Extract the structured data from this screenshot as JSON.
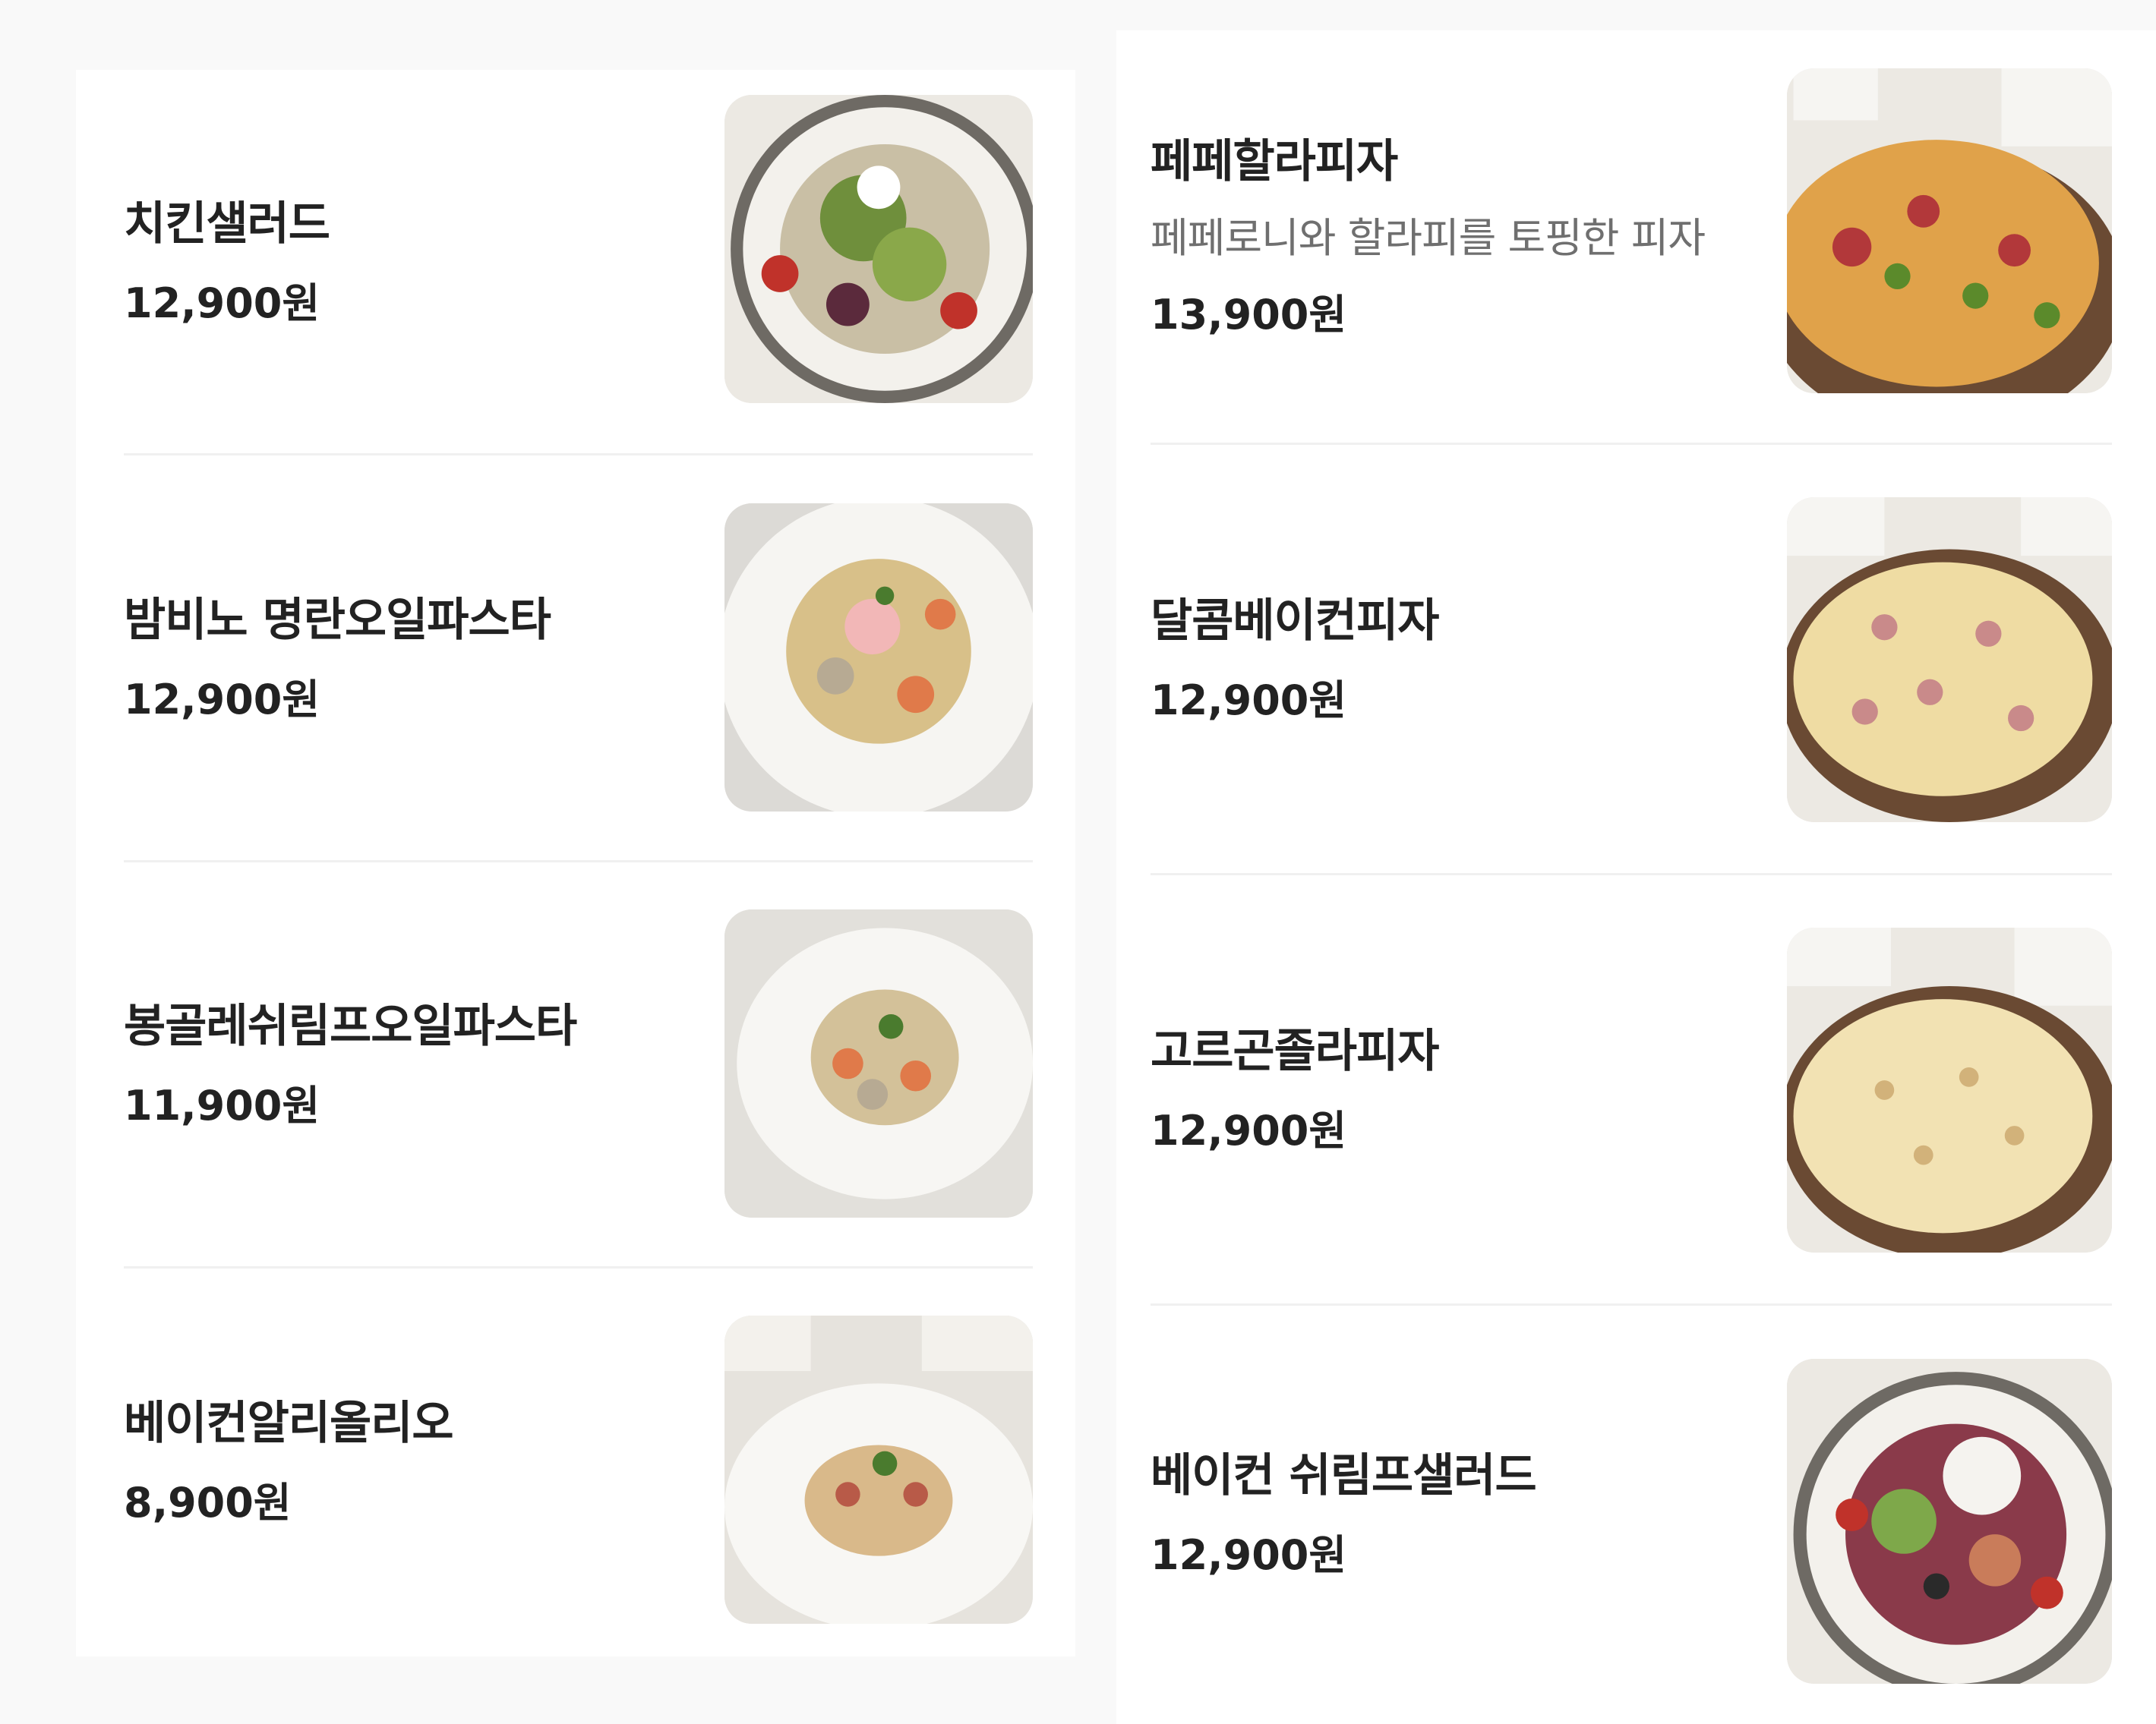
{
  "menu": {
    "left": [
      {
        "name": "치킨샐러드",
        "price": "12,900원",
        "photo": "salad-photo"
      },
      {
        "name": "밤비노 명란오일파스타",
        "price": "12,900원",
        "photo": "pasta-photo"
      },
      {
        "name": "봉골레쉬림프오일파스타",
        "price": "11,900원",
        "photo": "pasta-photo"
      },
      {
        "name": "베이컨알리올리오",
        "price": "8,900원",
        "photo": "pasta-photo"
      }
    ],
    "right": [
      {
        "name": "페페할라피자",
        "description": "페페로니와 할라피를 토핑한 피자",
        "price": "13,900원",
        "photo": "pizza-photo"
      },
      {
        "name": "달콤베이컨피자",
        "price": "12,900원",
        "photo": "pizza-photo"
      },
      {
        "name": "고르곤졸라피자",
        "price": "12,900원",
        "photo": "pizza-photo"
      },
      {
        "name": "베이컨 쉬림프샐러드",
        "price": "12,900원",
        "photo": "salad-photo"
      }
    ]
  }
}
